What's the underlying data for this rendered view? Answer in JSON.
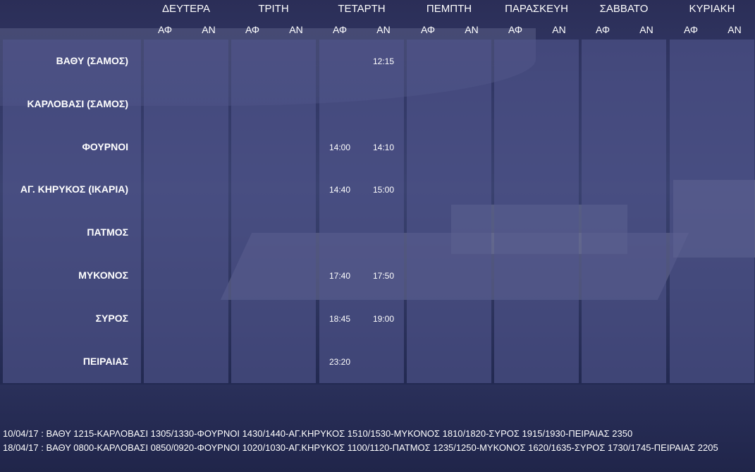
{
  "days": [
    "ΔΕΥΤΕΡΑ",
    "ΤΡΙΤΗ",
    "ΤΕΤΑΡΤΗ",
    "ΠΕΜΠΤΗ",
    "ΠΑΡΑΣΚΕΥΗ",
    "ΣΑΒΒΑΤΟ",
    "ΚΥΡΙΑΚΗ"
  ],
  "sub_labels": {
    "dep": "ΑΦ",
    "arr": "ΑΝ"
  },
  "stations": [
    "ΒΑΘΥ (ΣΑΜΟΣ)",
    "ΚΑΡΛΟΒΑΣΙ (ΣΑΜΟΣ)",
    "ΦΟΥΡΝΟΙ",
    "ΑΓ. ΚΗΡΥΚΟΣ (ΙΚΑΡΙΑ)",
    "ΠΑΤΜΟΣ",
    "ΜΥΚΟΝΟΣ",
    "ΣΥΡΟΣ",
    "ΠΕΙΡΑΙΑΣ"
  ],
  "wednesday_times": {
    "dep": [
      "",
      "",
      "14:00",
      "14:40",
      "",
      "17:40",
      "18:45",
      "23:20"
    ],
    "arr": [
      "12:15",
      "",
      "14:10",
      "15:00",
      "",
      "17:50",
      "19:00",
      ""
    ]
  },
  "notes": [
    "10/04/17 : ΒΑΘΥ 1215-ΚΑΡΛΟΒΑΣΙ 1305/1330-ΦΟΥΡΝΟΙ 1430/1440-ΑΓ.ΚΗΡΥΚΟΣ 1510/1530-ΜΥΚΟΝΟΣ 1810/1820-ΣΥΡΟΣ 1915/1930-ΠΕΙΡΑΙΑΣ 2350",
    "18/04/17 : ΒΑΘΥ 0800-ΚΑΡΛΟΒΑΣΙ 0850/0920-ΦΟΥΡΝΟΙ 1020/1030-ΑΓ.ΚΗΡΥΚΟΣ 1100/1120-ΠΑΤΜΟΣ 1235/1250-ΜΥΚΟΝΟΣ 1620/1635-ΣΥΡΟΣ 1730/1745-ΠΕΙΡΑΙΑΣ 2205"
  ]
}
